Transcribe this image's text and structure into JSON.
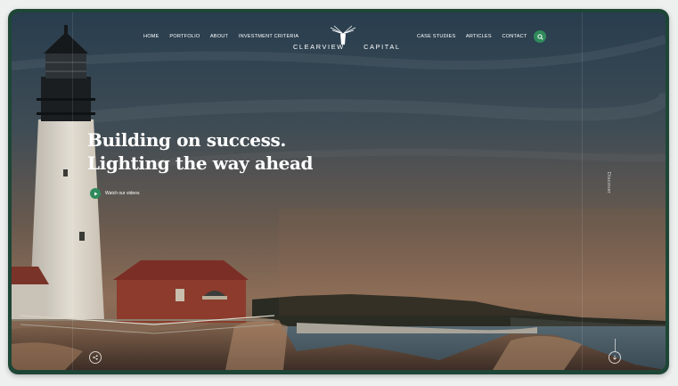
{
  "nav_left": [
    "HOME",
    "PORTFOLIO",
    "ABOUT",
    "INVESTMENT CRITERIA"
  ],
  "nav_right": [
    "CASE STUDIES",
    "ARTICLES",
    "CONTACT"
  ],
  "brand": {
    "left": "CLEARVIEW",
    "right": "CAPITAL"
  },
  "hero": {
    "line1": "Building on success.",
    "line2": "Lighting the way ahead",
    "video_label": "Watch our videos"
  },
  "discover_label": "Discover",
  "icons": {
    "search": "search-icon",
    "play": "play-icon",
    "share": "share-icon",
    "scroll": "arrow-down-icon",
    "logo": "lighthouse-beam-logo"
  },
  "colors": {
    "accent": "#2f8a5b",
    "frame": "#1e4636"
  }
}
